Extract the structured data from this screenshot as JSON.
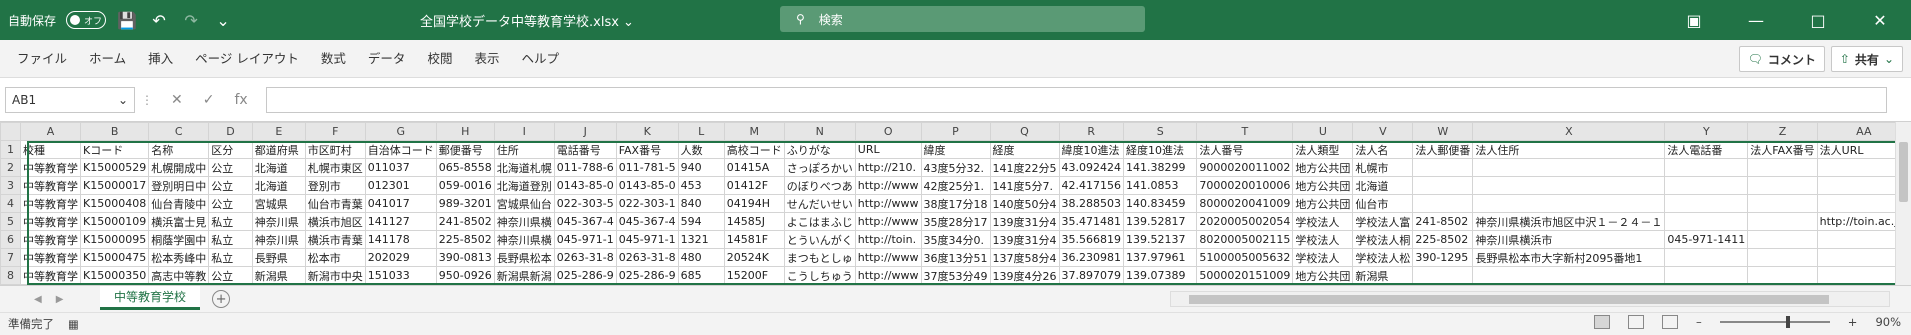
{
  "titlebar": {
    "autosave_label": "自動保存",
    "toggle_label": "オフ",
    "doc_title": "全国学校データ中等教育学校.xlsx",
    "search_placeholder": "検索"
  },
  "ribbon": {
    "tabs": [
      "ファイル",
      "ホーム",
      "挿入",
      "ページ レイアウト",
      "数式",
      "データ",
      "校閲",
      "表示",
      "ヘルプ"
    ],
    "comment_label": "コメント",
    "share_label": "共有"
  },
  "formula_bar": {
    "name_box": "AB1",
    "fx_label": "fx",
    "formula": ""
  },
  "grid": {
    "columns": [
      "A",
      "B",
      "C",
      "D",
      "E",
      "F",
      "G",
      "H",
      "I",
      "J",
      "K",
      "L",
      "M",
      "N",
      "O",
      "P",
      "Q",
      "R",
      "S",
      "T",
      "U",
      "V",
      "W",
      "X",
      "Y",
      "Z",
      "AA"
    ],
    "rows": [
      [
        "1",
        "校種",
        "Kコード",
        "名称",
        "区分",
        "都道府県",
        "市区町村",
        "自治体コード",
        "郵便番号",
        "住所",
        "電話番号",
        "FAX番号",
        "人数",
        "高校コード",
        "ふりがな",
        "URL",
        "緯度",
        "経度",
        "緯度10進法",
        "経度10進法",
        "法人番号",
        "法人類型",
        "法人名",
        "法人郵便番",
        "法人住所",
        "法人電話番",
        "法人FAX番号",
        "法人URL"
      ],
      [
        "2",
        "中等教育学",
        "K15000529",
        "札幌開成中",
        "公立",
        "北海道",
        "札幌市東区",
        "011037",
        "065-8558",
        "北海道札幌",
        "011-788-6",
        "011-781-5",
        "940",
        "01415A",
        "さっぽろかい",
        "http://210.",
        "43度5分32.",
        "141度22分5",
        "43.092424",
        "141.38299",
        "9000020011002",
        "地方公共団",
        "札幌市",
        "",
        "",
        "",
        "",
        ""
      ],
      [
        "3",
        "中等教育学",
        "K15000017",
        "登別明日中",
        "公立",
        "北海道",
        "登別市",
        "012301",
        "059-0016",
        "北海道登別",
        "0143-85-0",
        "0143-85-0",
        "453",
        "01412F",
        "のぼりべつあ",
        "http://www",
        "42度25分1.",
        "141度5分7.",
        "42.417156",
        "141.0853",
        "7000020010006",
        "地方公共団",
        "北海道",
        "",
        "",
        "",
        "",
        ""
      ],
      [
        "4",
        "中等教育学",
        "K15000408",
        "仙台青陵中",
        "公立",
        "宮城県",
        "仙台市青葉",
        "041017",
        "989-3201",
        "宮城県仙台",
        "022-303-5",
        "022-303-1",
        "840",
        "04194H",
        "せんだいせい",
        "http://www",
        "38度17分18",
        "140度50分4",
        "38.288503",
        "140.83459",
        "8000020041009",
        "地方公共団",
        "仙台市",
        "",
        "",
        "",
        "",
        ""
      ],
      [
        "5",
        "中等教育学",
        "K15000109",
        "横浜富士見",
        "私立",
        "神奈川県",
        "横浜市旭区",
        "141127",
        "241-8502",
        "神奈川県横",
        "045-367-4",
        "045-367-4",
        "594",
        "14585J",
        "よこはまふじ",
        "http://www",
        "35度28分17",
        "139度31分4",
        "35.471481",
        "139.52817",
        "2020005002054",
        "学校法人",
        "学校法人富",
        "241-8502",
        "神奈川県横浜市旭区中沢１－２４－１",
        "",
        "",
        "http://toin.ac.jp/"
      ],
      [
        "6",
        "中等教育学",
        "K15000095",
        "桐蔭学園中",
        "私立",
        "神奈川県",
        "横浜市青葉",
        "141178",
        "225-8502",
        "神奈川県横",
        "045-971-1",
        "045-971-1",
        "1321",
        "14581F",
        "とういんがく",
        "http://toin.",
        "35度34分0.",
        "139度31分4",
        "35.566819",
        "139.52137",
        "8020005002115",
        "学校法人",
        "学校法人桐",
        "225-8502",
        "神奈川県横浜市",
        "045-971-1411",
        "",
        ""
      ],
      [
        "7",
        "中等教育学",
        "K15000475",
        "松本秀峰中",
        "私立",
        "長野県",
        "松本市",
        "202029",
        "390-0813",
        "長野県松本",
        "0263-31-8",
        "0263-31-8",
        "480",
        "20524K",
        "まつもとしゅ",
        "http://www",
        "36度13分51",
        "137度58分4",
        "36.230981",
        "137.97961",
        "5100005005632",
        "学校法人",
        "学校法人松",
        "390-1295",
        "長野県松本市大字新村2095番地1",
        "",
        "",
        ""
      ],
      [
        "8",
        "中等教育学",
        "K15000350",
        "高志中等教",
        "公立",
        "新潟県",
        "新潟市中央",
        "151033",
        "950-0926",
        "新潟県新潟",
        "025-286-9",
        "025-286-9",
        "685",
        "15200F",
        "こうしちゅう",
        "http://www",
        "37度53分49",
        "139度4分26",
        "37.897079",
        "139.07389",
        "5000020151009",
        "地方公共団",
        "新潟県",
        "",
        "",
        "",
        "",
        ""
      ]
    ]
  },
  "sheet": {
    "tab_label": "中等教育学校"
  },
  "status": {
    "ready": "準備完了",
    "zoom": "90%"
  }
}
